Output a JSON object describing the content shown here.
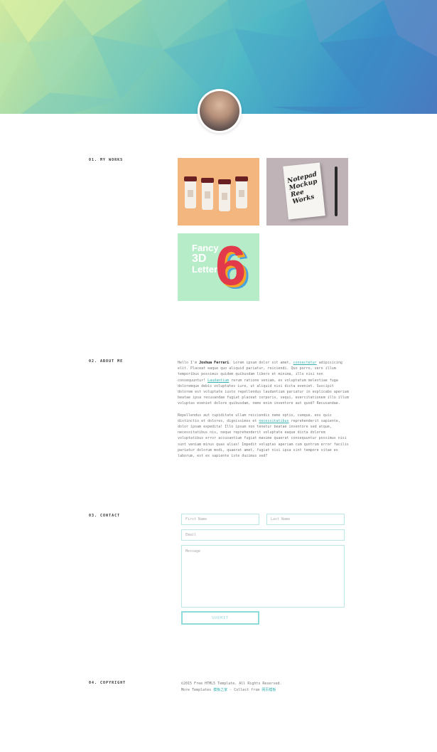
{
  "sections": {
    "works_label": "01. MY WORKS",
    "about_label": "02. ABOUT ME",
    "contact_label": "03. CONTACT",
    "copyright_label": "04. COPYRIGHT"
  },
  "works": {
    "notebook_lines": [
      "Notepad",
      "Mockup",
      "Ree",
      "Works"
    ],
    "fancy_text": [
      "Fancy",
      "3D",
      "Letter"
    ],
    "fancy_number": "6"
  },
  "about": {
    "intro": "Hello I'm",
    "name": "Joshua Ferrari",
    "p1_a": ". Lorem ipsum dolor sit amet,",
    "p1_link1": "consectetur",
    "p1_b": "adipisicing elit. Placeat eaque quo aliquid pariatur, reiciendi. Quo porro, vero illum temporibus possimus quidem quibusdam libero et minima, illo nisi non consequuntur!",
    "p1_link2": "Laudantium",
    "p1_c": "rerum ratione veniam, ex voluptatum molestiae fuga doloremque debis voluptates iure, ut aliquid nisi dicta eveniet. Suscipit dolorem est voluptate iusto repellendus laudantium pariatur in explicabo aperiam beatae ipsa recusandae fugiat placeat corporis, sequi, exercitationem illo illum voluptas eveniet dolore quibusdam, nemo enim inventore aut quod? Recusandae.",
    "p2_a": "Repellendus aut cupiditate ullam reiciendis nemo optio, cumque, eos quis distinctio et dolores, dignissimos et",
    "p2_link": "necessitatibus",
    "p2_b": "reprehenderit sapiente, dolor ipsam expedita! Illo ipsum non tenetur beatae inventore sed atque, necessitatibus nis, neque reprehenderit voluptate eaque dicta dolorem voluptatibus error accusantium fugiat maxime quaerat consequuntur possimus nisi sunt veniam minus quas alias! Impedit voluptas aperiam cum quntrum error facilis pariatur dolorum modi, quaerat amet, fugiat nisi ipsa sint tempore vitae ex laborum, est ex sapiente iste ducimus sed?"
  },
  "contact": {
    "first_name_placeholder": "First Name",
    "last_name_placeholder": "Last Name",
    "email_placeholder": "Email",
    "message_placeholder": "Message",
    "submit_label": "SUBMIT"
  },
  "copyright": {
    "line1": "©2015 Free HTML5 Template. All Rights Reserved.",
    "line2_a": "More Templates",
    "line2_link1": "模板之家",
    "line2_b": "- Collect from",
    "line2_link2": "网页模板"
  }
}
